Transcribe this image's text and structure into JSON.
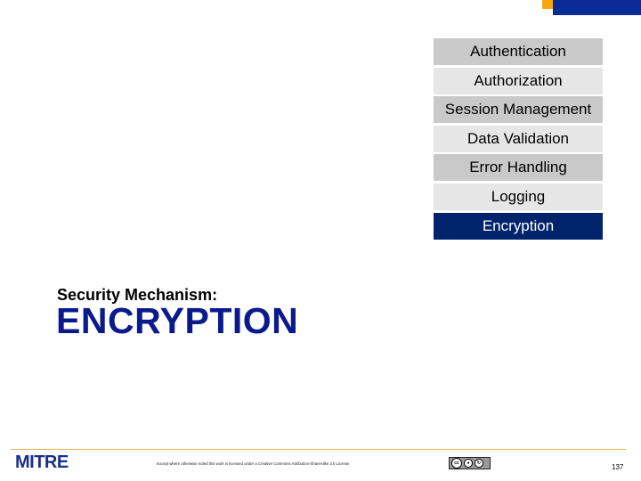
{
  "menu": {
    "items": [
      {
        "label": "Authentication",
        "state": "dark"
      },
      {
        "label": "Authorization",
        "state": "light"
      },
      {
        "label": "Session Management",
        "state": "dark"
      },
      {
        "label": "Data Validation",
        "state": "light"
      },
      {
        "label": "Error Handling",
        "state": "dark"
      },
      {
        "label": "Logging",
        "state": "light"
      },
      {
        "label": "Encryption",
        "state": "active"
      }
    ]
  },
  "heading": {
    "subtitle": "Security Mechanism:",
    "title": "ENCRYPTION"
  },
  "footer": {
    "logo": "MITRE",
    "license": "Except where otherwise noted this work is licensed under a Creative Commons Attribution-ShareAlike 3.0 License",
    "cc_badge": {
      "cc": "cc",
      "by": "BY",
      "sa": "SA"
    },
    "page_number": "137"
  },
  "colors": {
    "accent_orange": "#f5a70f",
    "brand_blue": "#0a2b96",
    "active_item": "#00246b",
    "title_blue": "#0a1a8c"
  }
}
